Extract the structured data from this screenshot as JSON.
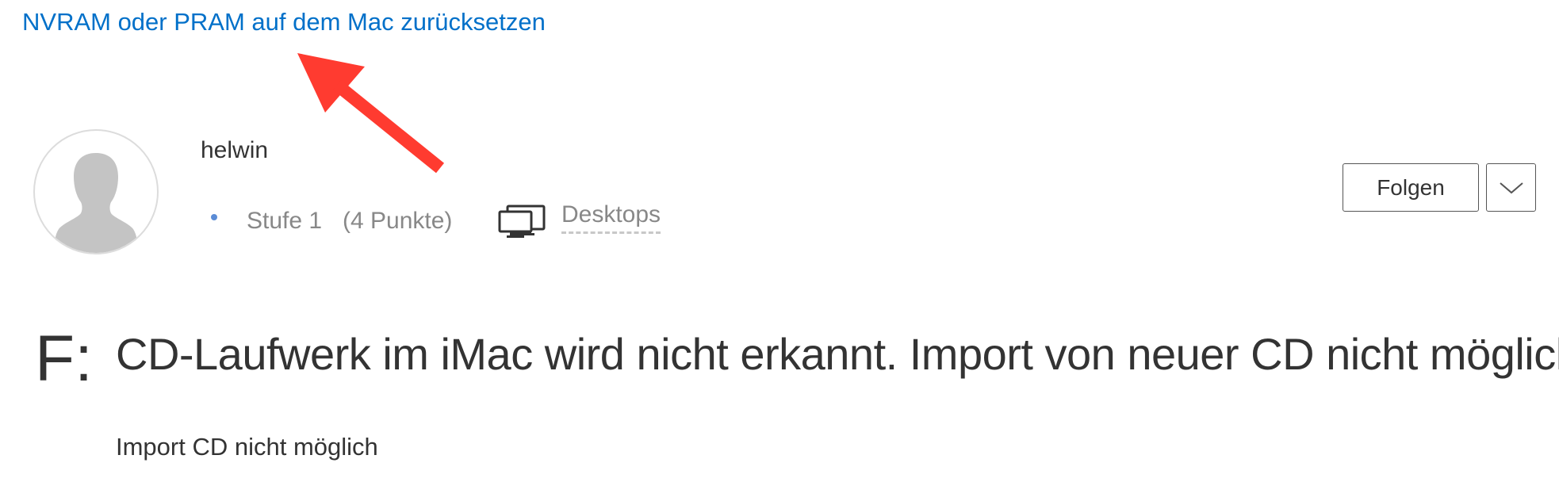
{
  "top_link": {
    "label": "NVRAM oder PRAM auf dem Mac zurücksetzen"
  },
  "annotation": {
    "arrow_color": "#ff3b30",
    "icon": "red-arrow-icon"
  },
  "author": {
    "avatar_icon": "default-user-avatar-icon",
    "name": "helwin",
    "level": "Stufe 1",
    "points": "(4 Punkte)",
    "community_icon": "desktops-icon",
    "community": "Desktops"
  },
  "actions": {
    "follow_label": "Folgen",
    "dropdown_icon": "chevron-down-icon"
  },
  "question": {
    "marker": "F:",
    "title": "CD-Laufwerk im iMac wird nicht erkannt. Import von neuer CD nicht möglich.",
    "body": "Import CD nicht möglich"
  },
  "colors": {
    "link": "#0070c9",
    "level_dot": "#5b8cd6",
    "muted_text": "#888888",
    "text": "#333333"
  }
}
